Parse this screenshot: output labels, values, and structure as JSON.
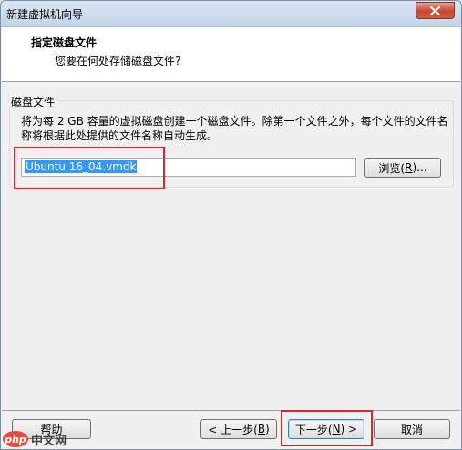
{
  "window": {
    "title": "新建虚拟机向导"
  },
  "header": {
    "title": "指定磁盘文件",
    "subtitle": "您要在何处存储磁盘文件?"
  },
  "disk_group": {
    "legend": "磁盘文件",
    "description": "将为每 2 GB 容量的虚拟磁盘创建一个磁盘文件。除第一个文件之外，每个文件的文件名称将根据此处提供的文件名称自动生成。",
    "filename_value": "Ubuntu 16_04.vmdk",
    "browse_label_pre": "浏览(",
    "browse_key": "R",
    "browse_label_post": ")..."
  },
  "footer": {
    "help_label": "帮助",
    "back_pre": "< 上一步(",
    "back_key": "B",
    "back_post": ")",
    "next_pre": "下一步(",
    "next_key": "N",
    "next_post": ") >",
    "cancel_label": "取消"
  },
  "watermark": {
    "logo": "php",
    "text": "中文网"
  },
  "colors": {
    "highlight": "#e0252a",
    "selection": "#3399ff",
    "close_button": "#c7452f"
  }
}
